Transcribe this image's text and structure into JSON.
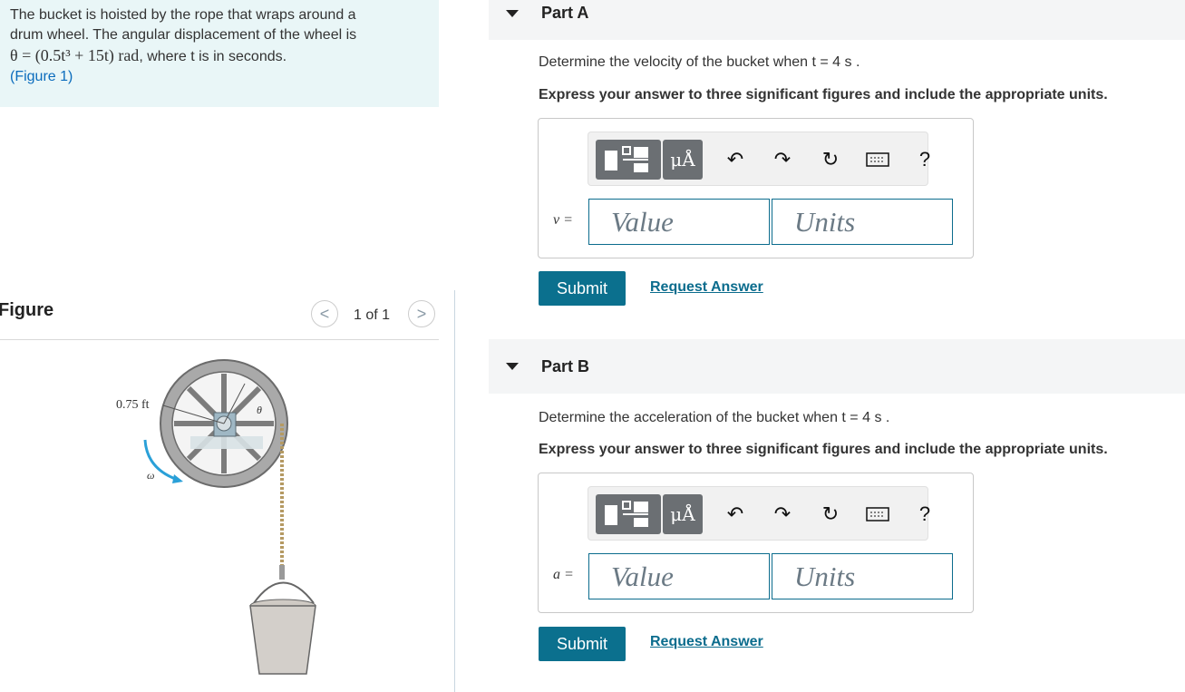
{
  "problem": {
    "line1": "The bucket is hoisted by the rope that wraps around a",
    "line2": "drum wheel. The angular displacement of the wheel is",
    "eq_lhs": "θ = ",
    "eq_body": "(0.5t³ + 15t)",
    "eq_unit": " rad",
    "eq_tail": ", where t is in seconds.",
    "figure_link": "(Figure 1)"
  },
  "figure": {
    "title": "Figure",
    "pager": "1 of 1",
    "prev_glyph": "<",
    "next_glyph": ">",
    "radius_label": "0.75 ft",
    "theta_label": "θ",
    "omega_label": "ω"
  },
  "parts": [
    {
      "title": "Part A",
      "question": "Determine the velocity of the bucket when t = 4 s .",
      "instruction": "Express your answer to three significant figures and include the appropriate units.",
      "var_label": "v =",
      "value_placeholder": "Value",
      "units_placeholder": "Units",
      "submit": "Submit",
      "request": "Request Answer"
    },
    {
      "title": "Part B",
      "question": "Determine the acceleration of the bucket when t = 4 s .",
      "instruction": "Express your answer to three significant figures and include the appropriate units.",
      "var_label": "a =",
      "value_placeholder": "Value",
      "units_placeholder": "Units",
      "submit": "Submit",
      "request": "Request Answer"
    }
  ],
  "toolbar": {
    "units_glyph": "μÅ",
    "help_glyph": "?"
  },
  "icons": [
    "templates-icon",
    "units-icon",
    "undo-icon",
    "redo-icon",
    "reset-icon",
    "keyboard-icon",
    "help-icon",
    "caret-down-icon"
  ],
  "colors": {
    "accent": "#0b708e",
    "problem_bg": "#e9f6f7",
    "header_bg": "#f4f5f6"
  }
}
